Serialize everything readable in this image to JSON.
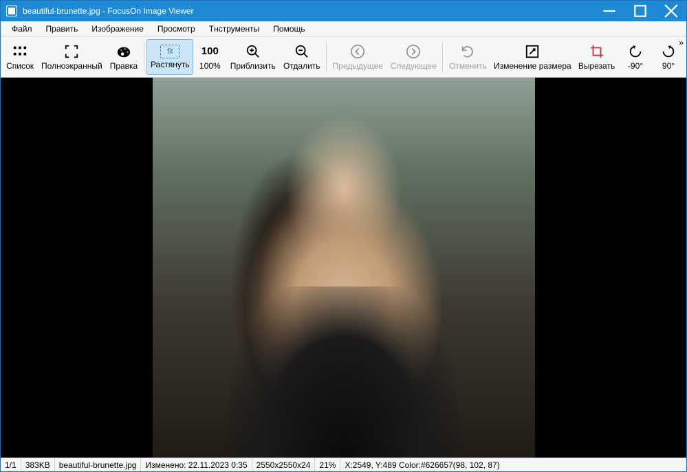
{
  "title": "beautiful-brunette.jpg - FocusOn Image Viewer",
  "menu": {
    "file": "Файл",
    "edit": "Править",
    "image": "Изображение",
    "view": "Просмотр",
    "tools": "Тнструменты",
    "help": "Помощь"
  },
  "toolbar": {
    "list": "Список",
    "fullscreen": "Полноэкранный",
    "brush": "Правка",
    "fit": "Растянуть",
    "hundred": "100%",
    "hundred_icon": "100",
    "zoomin": "Приблизить",
    "zoomout": "Отдалить",
    "prev": "Предыдущее",
    "next": "Следующее",
    "undo": "Отменить",
    "resize": "Изменение размера",
    "crop": "Вырезать",
    "rot_neg90": "-90°",
    "rot_90": "90°",
    "fit_glyph": "fit"
  },
  "status": {
    "index": "1/1",
    "size": "383KB",
    "filename": "beautiful-brunette.jpg",
    "modified": "Изменено: 22.11.2023 0:35",
    "dims": "2550x2550x24",
    "zoom": "21%",
    "coords": "X:2549, Y:489 Color:#626657(98, 102, 87)"
  }
}
